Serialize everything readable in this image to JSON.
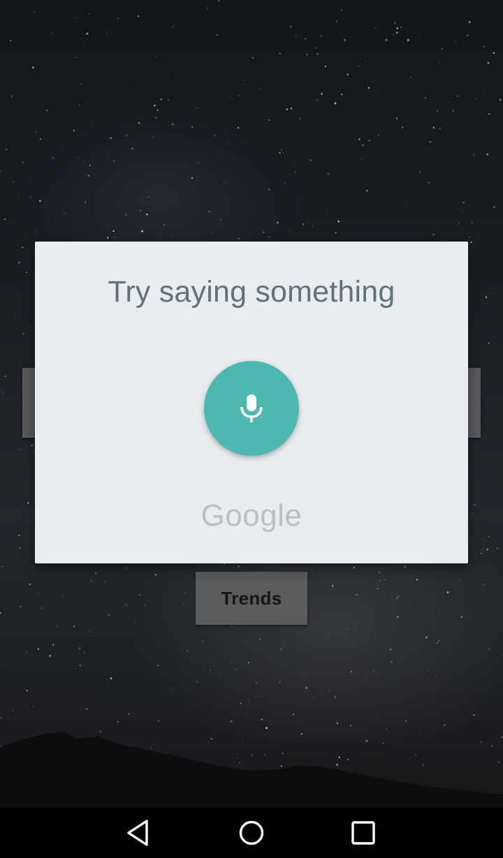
{
  "dialog": {
    "title": "Try saying something",
    "mic_icon": "microphone-icon",
    "logo_text": "Google"
  },
  "background": {
    "trends_label": "Trends"
  },
  "navbar": {
    "back_icon": "back-icon",
    "home_icon": "home-icon",
    "recents_icon": "recents-icon"
  },
  "colors": {
    "dialog_bg": "#e9edf0",
    "title_text": "#5d7380",
    "mic_accent": "#4fb8ae",
    "logo_gray": "#bcbfc2",
    "navbar_bg": "#000000"
  }
}
